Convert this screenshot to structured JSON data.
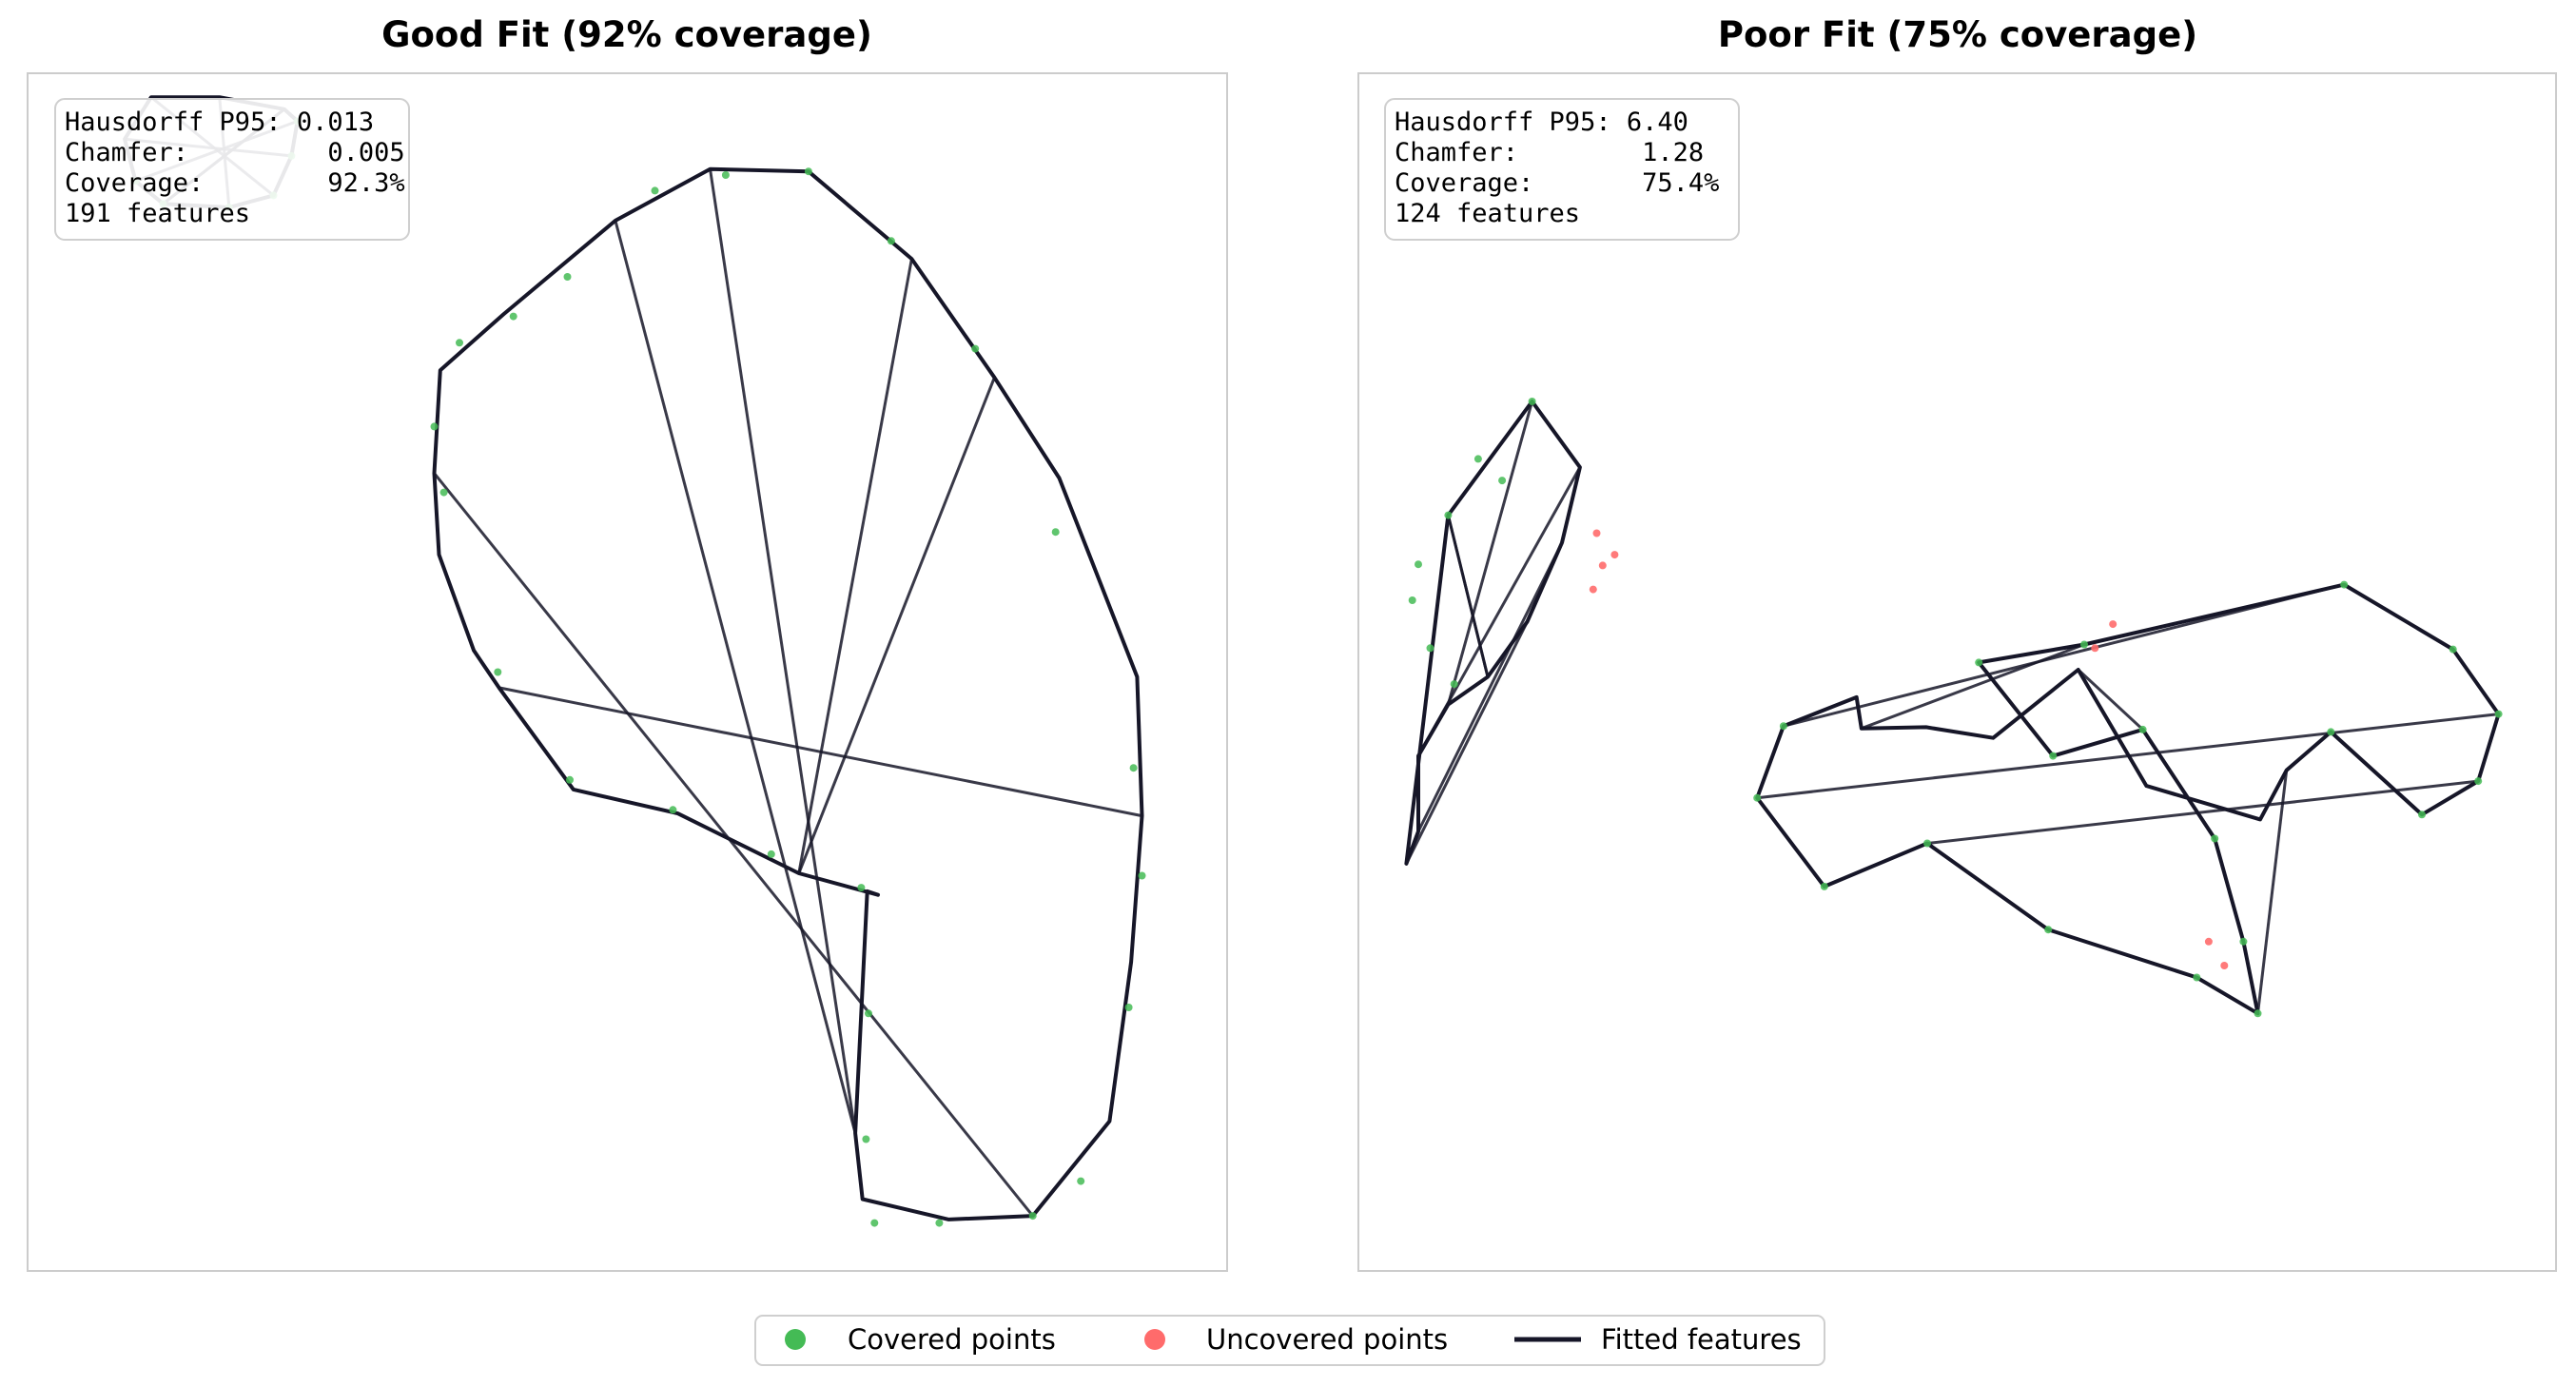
{
  "chart_data": [
    {
      "type": "scatter",
      "title": "Good Fit (92% coverage)",
      "stats": {
        "line1": "Hausdorff P95: 0.013",
        "line2": "Chamfer:         0.005",
        "line3": "Coverage:        92.3%",
        "line4": "191 features"
      },
      "metrics": {
        "hausdorff_p95": 0.013,
        "chamfer": 0.005,
        "coverage_pct": 92.3,
        "features": 191
      },
      "xlim": [
        0,
        1
      ],
      "ylim": [
        0,
        1
      ],
      "shapes": [
        {
          "kind": "blob",
          "closed": true,
          "polyline": [
            [
              0.569,
              0.92
            ],
            [
              0.651,
              0.918
            ],
            [
              0.737,
              0.845
            ],
            [
              0.806,
              0.746
            ],
            [
              0.86,
              0.662
            ],
            [
              0.925,
              0.496
            ],
            [
              0.929,
              0.38
            ],
            [
              0.92,
              0.258
            ],
            [
              0.902,
              0.125
            ],
            [
              0.838,
              0.046
            ],
            [
              0.768,
              0.043
            ],
            [
              0.696,
              0.06
            ],
            [
              0.69,
              0.115
            ],
            [
              0.7,
              0.317
            ],
            [
              0.709,
              0.314
            ],
            [
              0.643,
              0.332
            ],
            [
              0.542,
              0.382
            ],
            [
              0.455,
              0.402
            ],
            [
              0.393,
              0.487
            ],
            [
              0.372,
              0.518
            ],
            [
              0.343,
              0.598
            ],
            [
              0.339,
              0.666
            ],
            [
              0.344,
              0.752
            ],
            [
              0.397,
              0.799
            ],
            [
              0.49,
              0.877
            ]
          ],
          "covered": [
            [
              0.523,
              0.902
            ],
            [
              0.582,
              0.915
            ],
            [
              0.651,
              0.918
            ],
            [
              0.72,
              0.86
            ],
            [
              0.79,
              0.77
            ],
            [
              0.857,
              0.617
            ],
            [
              0.922,
              0.42
            ],
            [
              0.929,
              0.33
            ],
            [
              0.918,
              0.22
            ],
            [
              0.878,
              0.075
            ],
            [
              0.838,
              0.046
            ],
            [
              0.76,
              0.04
            ],
            [
              0.706,
              0.04
            ],
            [
              0.699,
              0.11
            ],
            [
              0.701,
              0.215
            ],
            [
              0.695,
              0.32
            ],
            [
              0.62,
              0.348
            ],
            [
              0.538,
              0.385
            ],
            [
              0.452,
              0.41
            ],
            [
              0.392,
              0.5
            ],
            [
              0.347,
              0.65
            ],
            [
              0.339,
              0.705
            ],
            [
              0.36,
              0.775
            ],
            [
              0.405,
              0.797
            ],
            [
              0.45,
              0.83
            ]
          ],
          "uncovered": []
        },
        {
          "kind": "ring",
          "closed": true,
          "polyline": [
            [
              0.113,
              0.891
            ],
            [
              0.168,
              0.888
            ],
            [
              0.205,
              0.898
            ],
            [
              0.22,
              0.931
            ],
            [
              0.225,
              0.96
            ],
            [
              0.214,
              0.97
            ],
            [
              0.16,
              0.98
            ],
            [
              0.103,
              0.98
            ],
            [
              0.081,
              0.945
            ],
            [
              0.09,
              0.91
            ]
          ],
          "covered": [
            [
              0.113,
              0.891
            ],
            [
              0.168,
              0.888
            ],
            [
              0.205,
              0.898
            ],
            [
              0.22,
              0.931
            ],
            [
              0.225,
              0.96
            ],
            [
              0.09,
              0.91
            ]
          ],
          "uncovered": []
        }
      ]
    },
    {
      "type": "scatter",
      "title": "Poor Fit (75% coverage)",
      "stats": {
        "line1": "Hausdorff P95: 6.40",
        "line2": "Chamfer:        1.28",
        "line3": "Coverage:       75.4%",
        "line4": "124 features"
      },
      "metrics": {
        "hausdorff_p95": 6.4,
        "chamfer": 1.28,
        "coverage_pct": 75.4,
        "features": 124
      },
      "xlim": [
        0,
        1
      ],
      "ylim": [
        0,
        1
      ],
      "shapes": [
        {
          "kind": "ring",
          "closed": true,
          "polyline": [
            [
              0.075,
              0.631
            ],
            [
              0.145,
              0.726
            ],
            [
              0.185,
              0.671
            ],
            [
              0.17,
              0.608
            ],
            [
              0.141,
              0.542
            ],
            [
              0.108,
              0.496
            ],
            [
              0.075,
              0.473
            ],
            [
              0.05,
              0.43
            ],
            [
              0.05,
              0.367
            ],
            [
              0.04,
              0.34
            ]
          ],
          "covered": [
            [
              0.075,
              0.631
            ],
            [
              0.12,
              0.66
            ],
            [
              0.145,
              0.726
            ],
            [
              0.1,
              0.678
            ],
            [
              0.05,
              0.59
            ],
            [
              0.045,
              0.56
            ],
            [
              0.06,
              0.52
            ],
            [
              0.08,
              0.49
            ]
          ],
          "uncovered": [
            [
              0.196,
              0.569
            ],
            [
              0.204,
              0.589
            ],
            [
              0.199,
              0.616
            ],
            [
              0.214,
              0.598
            ]
          ]
        },
        {
          "kind": "double-capsule",
          "closed": true,
          "polyline": [
            [
              0.355,
              0.455
            ],
            [
              0.333,
              0.395
            ],
            [
              0.389,
              0.321
            ],
            [
              0.475,
              0.357
            ],
            [
              0.576,
              0.285
            ],
            [
              0.7,
              0.245
            ],
            [
              0.751,
              0.215
            ],
            [
              0.739,
              0.275
            ],
            [
              0.715,
              0.361
            ],
            [
              0.655,
              0.452
            ],
            [
              0.58,
              0.43
            ],
            [
              0.518,
              0.508
            ],
            [
              0.606,
              0.523
            ],
            [
              0.823,
              0.573
            ],
            [
              0.914,
              0.519
            ],
            [
              0.952,
              0.465
            ],
            [
              0.935,
              0.409
            ],
            [
              0.888,
              0.381
            ],
            [
              0.812,
              0.45
            ],
            [
              0.775,
              0.418
            ],
            [
              0.753,
              0.377
            ],
            [
              0.658,
              0.405
            ],
            [
              0.601,
              0.502
            ],
            [
              0.53,
              0.445
            ],
            [
              0.474,
              0.454
            ],
            [
              0.42,
              0.453
            ],
            [
              0.416,
              0.479
            ]
          ],
          "covered": [
            [
              0.355,
              0.455
            ],
            [
              0.333,
              0.395
            ],
            [
              0.389,
              0.321
            ],
            [
              0.475,
              0.357
            ],
            [
              0.576,
              0.285
            ],
            [
              0.7,
              0.245
            ],
            [
              0.751,
              0.215
            ],
            [
              0.739,
              0.275
            ],
            [
              0.715,
              0.361
            ],
            [
              0.655,
              0.452
            ],
            [
              0.58,
              0.43
            ],
            [
              0.518,
              0.508
            ],
            [
              0.606,
              0.523
            ],
            [
              0.823,
              0.573
            ],
            [
              0.914,
              0.519
            ],
            [
              0.952,
              0.465
            ],
            [
              0.935,
              0.409
            ],
            [
              0.888,
              0.381
            ],
            [
              0.812,
              0.45
            ]
          ],
          "uncovered": [
            [
              0.723,
              0.255
            ],
            [
              0.71,
              0.275
            ],
            [
              0.615,
              0.52
            ],
            [
              0.63,
              0.54
            ]
          ]
        }
      ]
    }
  ],
  "legend": {
    "covered_label": "Covered points",
    "uncovered_label": "Uncovered points",
    "fitted_label": "Fitted features",
    "covered_color": "#44bb55",
    "uncovered_color": "#ff6b6b",
    "fitted_color": "#161628"
  }
}
